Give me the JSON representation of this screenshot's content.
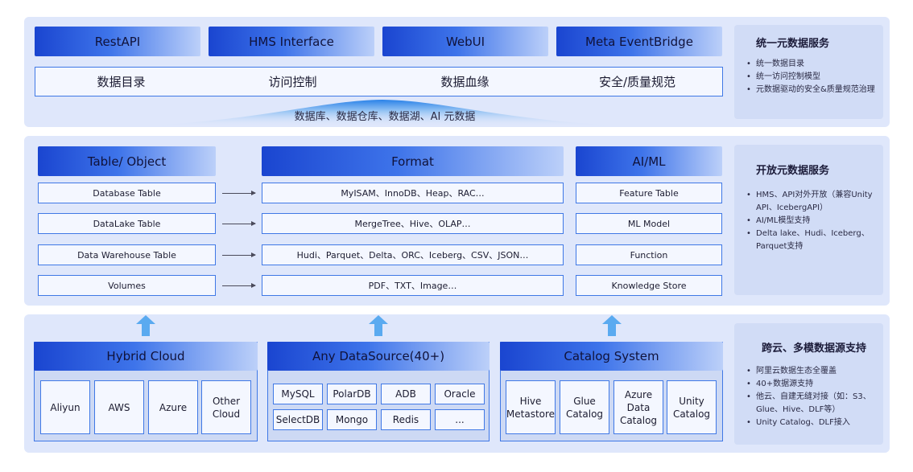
{
  "layer1": {
    "headers": [
      "RestAPI",
      "HMS Interface",
      "WebUI",
      "Meta EventBridge"
    ],
    "capabilities": [
      "数据目录",
      "访问控制",
      "数据血缘",
      "安全/质量规范"
    ],
    "meta_text": "数据库、数据仓库、数据湖、AI 元数据",
    "side": {
      "title": "统一元数据服务",
      "items": [
        "统一数据目录",
        "统一访问控制模型",
        "元数据驱动的安全&质量规范治理"
      ]
    }
  },
  "layer2": {
    "table_object": {
      "header": "Table/ Object",
      "rows": [
        "Database Table",
        "DataLake Table",
        "Data Warehouse Table",
        "Volumes"
      ]
    },
    "format": {
      "header": "Format",
      "rows": [
        "MyISAM、InnoDB、Heap、RAC…",
        "MergeTree、Hive、OLAP…",
        "Hudi、Parquet、Delta、ORC、Iceberg、CSV、JSON…",
        "PDF、TXT、Image…"
      ]
    },
    "aiml": {
      "header": "AI/ML",
      "rows": [
        "Feature Table",
        "ML Model",
        "Function",
        "Knowledge Store"
      ]
    },
    "side": {
      "title": "开放元数据服务",
      "items": [
        "HMS、API对外开放（兼容Unity API、IcebergAPI）",
        "AI/ML模型支持",
        "Delta lake、Hudi、Iceberg、Parquet支持"
      ]
    }
  },
  "layer3": {
    "hybrid": {
      "header": "Hybrid Cloud",
      "cells": [
        "Aliyun",
        "AWS",
        "Azure",
        "Other Cloud"
      ]
    },
    "datasource": {
      "header": "Any DataSource(40+)",
      "cells": [
        "MySQL",
        "PolarDB",
        "ADB",
        "Oracle",
        "SelectDB",
        "Mongo",
        "Redis",
        "..."
      ]
    },
    "catalog": {
      "header": "Catalog System",
      "cells": [
        "Hive Metastore",
        "Glue Catalog",
        "Azure Data Catalog",
        "Unity Catalog"
      ]
    },
    "side": {
      "title": "跨云、多模数据源支持",
      "items": [
        "阿里云数据生态全覆盖",
        "40+数据源支持",
        "他云、自建无缝对接（如：S3、Glue、Hive、DLF等）",
        "Unity Catalog、DLF接入"
      ]
    }
  },
  "colors": {
    "band": "#dfe7fb",
    "side_panel": "#d1dcf6",
    "header_start": "#1a45d0",
    "header_end": "#bcd0f9",
    "border": "#3f78e6",
    "arrow": "#5aaaf0"
  }
}
